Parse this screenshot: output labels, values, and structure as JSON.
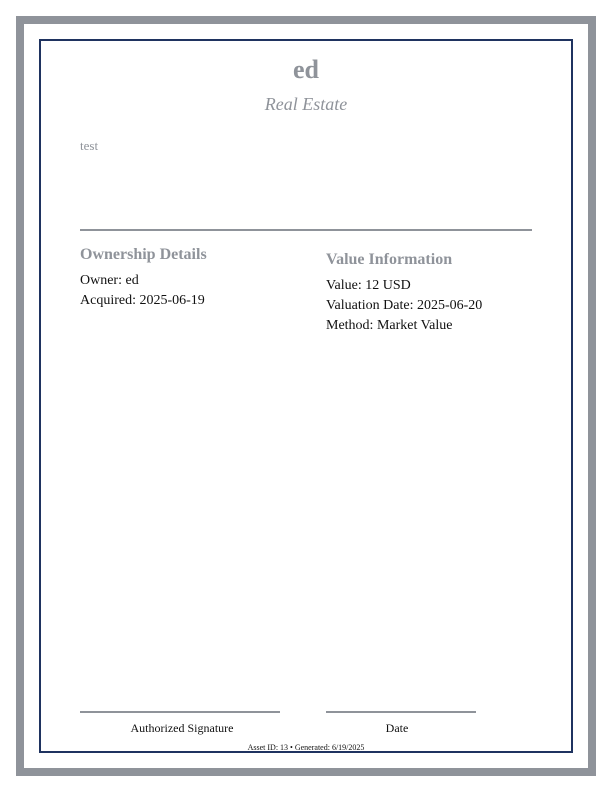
{
  "document": {
    "title": "ed",
    "subtitle": "Real Estate",
    "description": "test"
  },
  "ownership": {
    "heading": "Ownership Details",
    "owner": "Owner: ed",
    "acquired": "Acquired: 2025-06-19"
  },
  "value_info": {
    "heading": "Value Information",
    "value": "Value: 12 USD",
    "valuation_date": "Valuation Date: 2025-06-20",
    "method": "Method: Market Value"
  },
  "signatures": {
    "authorized_label": "Authorized Signature",
    "date_label": "Date"
  },
  "footer": {
    "text": "Asset ID: 13 • Generated: 6/19/2025"
  },
  "colors": {
    "frame_gray": "#8f939a",
    "border_navy": "#1f3360",
    "text_dark": "#111111"
  }
}
